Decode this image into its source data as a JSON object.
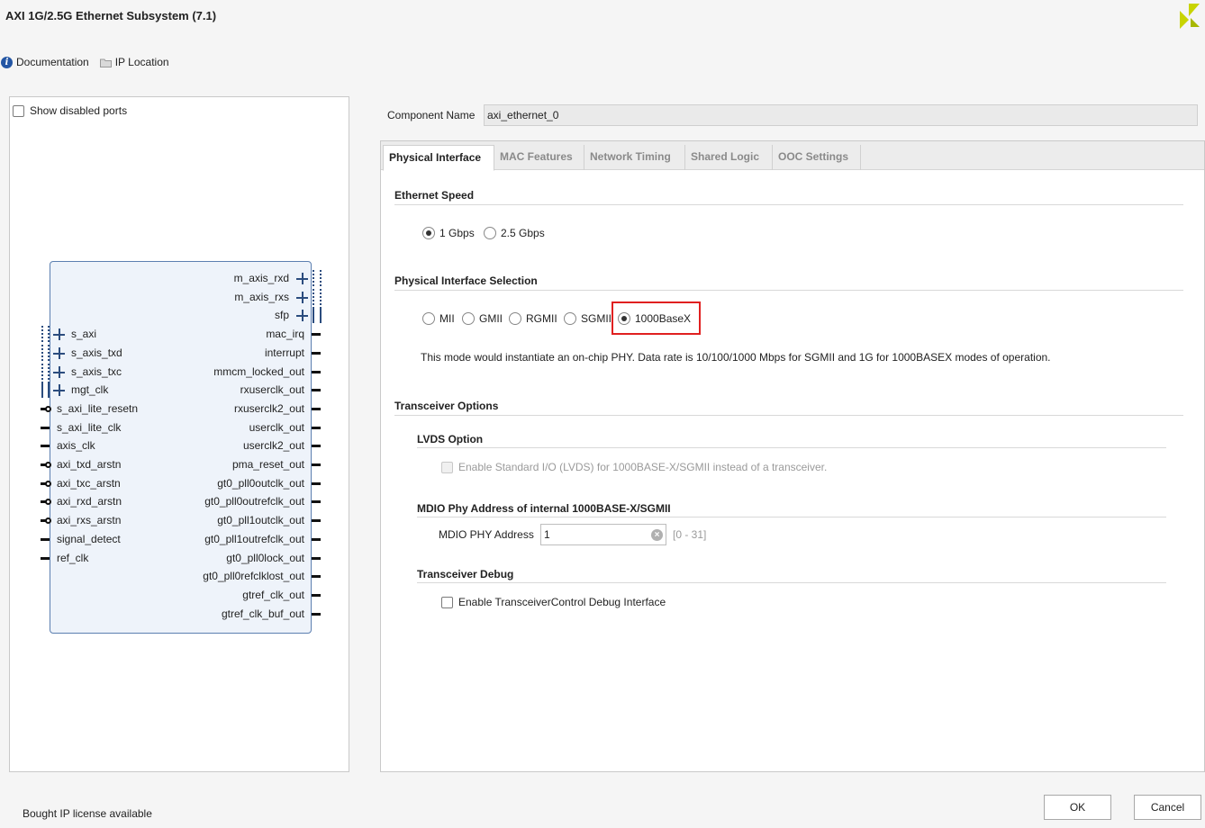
{
  "window": {
    "title": "AXI 1G/2.5G Ethernet Subsystem (7.1)",
    "logo_icon": "xilinx-logo-icon"
  },
  "toolbar": {
    "documentation_label": "Documentation",
    "ip_location_label": "IP Location"
  },
  "left_panel": {
    "show_disabled_ports_label": "Show disabled ports",
    "show_disabled_ports_checked": false,
    "block": {
      "left_bus_ports": [
        "s_axi",
        "s_axis_txd",
        "s_axis_txc",
        "mgt_clk"
      ],
      "left_pin_ports": [
        "s_axi_lite_resetn",
        "s_axi_lite_clk",
        "axis_clk",
        "axi_txd_arstn",
        "axi_txc_arstn",
        "axi_rxd_arstn",
        "axi_rxs_arstn",
        "signal_detect",
        "ref_clk"
      ],
      "right_bus_ports": [
        "m_axis_rxd",
        "m_axis_rxs",
        "sfp"
      ],
      "right_pin_ports": [
        "mac_irq",
        "interrupt",
        "mmcm_locked_out",
        "rxuserclk_out",
        "rxuserclk2_out",
        "userclk_out",
        "userclk2_out",
        "pma_reset_out",
        "gt0_pll0outclk_out",
        "gt0_pll0outrefclk_out",
        "gt0_pll1outclk_out",
        "gt0_pll1outrefclk_out",
        "gt0_pll0lock_out",
        "gt0_pll0refclklost_out",
        "gtref_clk_out",
        "gtref_clk_buf_out"
      ]
    }
  },
  "component": {
    "label": "Component Name",
    "value": "axi_ethernet_0"
  },
  "tabs": [
    {
      "label": "Physical Interface",
      "active": true
    },
    {
      "label": "MAC Features",
      "active": false
    },
    {
      "label": "Network Timing",
      "active": false
    },
    {
      "label": "Shared Logic",
      "active": false
    },
    {
      "label": "OOC Settings",
      "active": false
    }
  ],
  "ethernet_speed": {
    "title": "Ethernet Speed",
    "options": [
      "1 Gbps",
      "2.5 Gbps"
    ],
    "selected": "1 Gbps"
  },
  "phy_selection": {
    "title": "Physical Interface Selection",
    "options": [
      "MII",
      "GMII",
      "RGMII",
      "SGMII",
      "1000BaseX"
    ],
    "selected": "1000BaseX",
    "description": "This mode would instantiate an on-chip PHY. Data rate is 10/100/1000 Mbps for SGMII and 1G for 1000BASEX modes of operation."
  },
  "transceiver": {
    "title": "Transceiver Options",
    "lvds": {
      "title": "LVDS Option",
      "checkbox_label": "Enable Standard I/O (LVDS) for 1000BASE-X/SGMII instead of a transceiver.",
      "enabled": false
    },
    "mdio": {
      "title": "MDIO Phy Address of internal 1000BASE-X/SGMII",
      "label": "MDIO PHY Address",
      "value": "1",
      "range": "[0 - 31]"
    },
    "debug": {
      "title": "Transceiver Debug",
      "checkbox_label": "Enable TransceiverControl Debug Interface",
      "checked": false
    }
  },
  "footer": {
    "license_text": "Bought IP license available",
    "ok_label": "OK",
    "cancel_label": "Cancel"
  }
}
